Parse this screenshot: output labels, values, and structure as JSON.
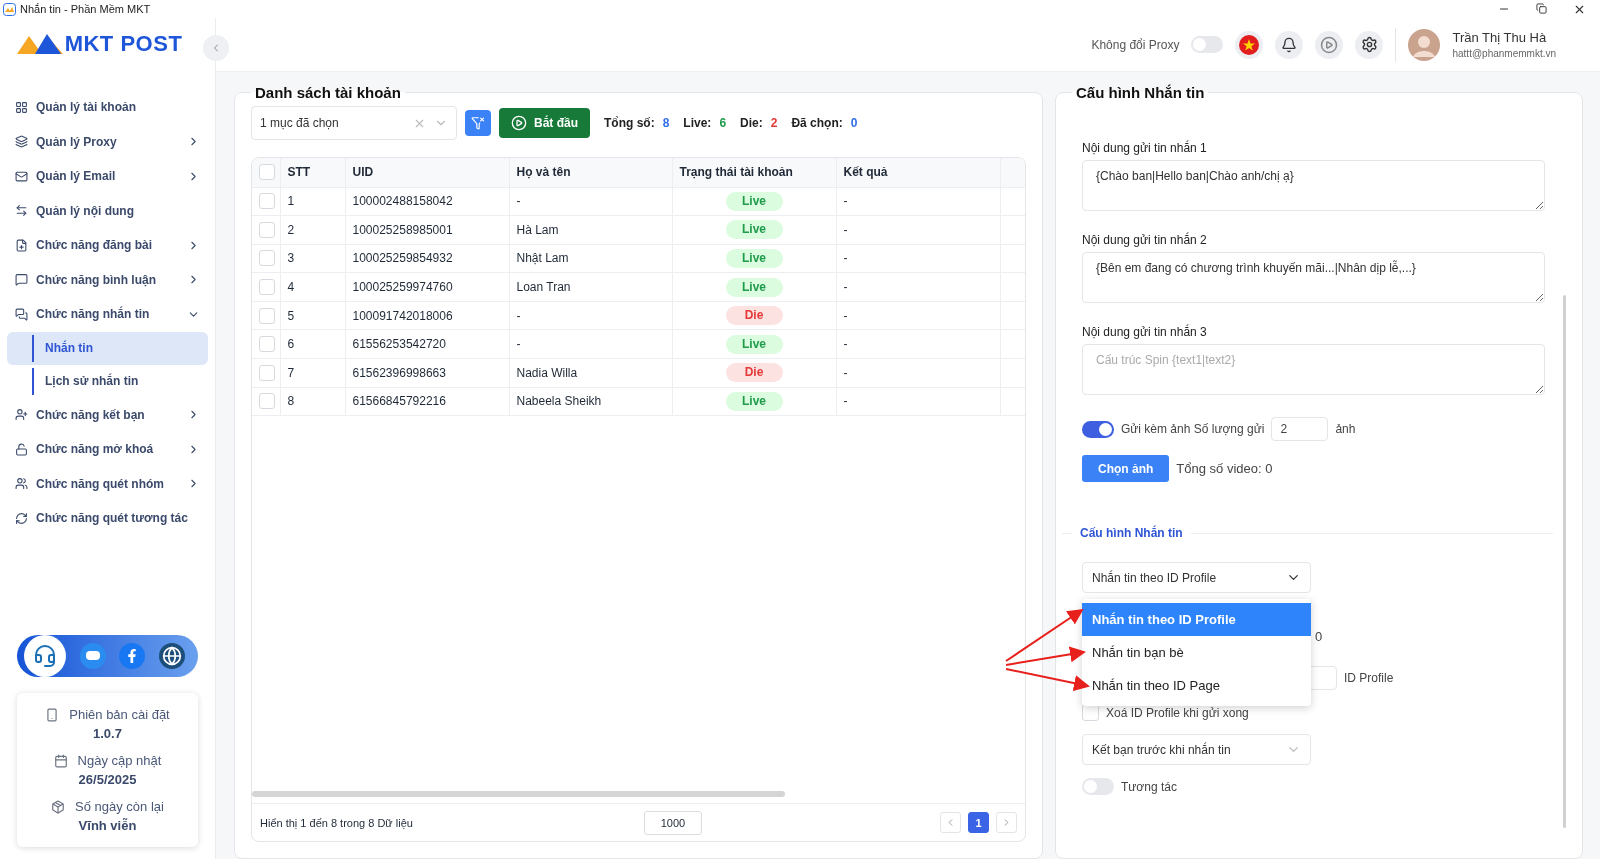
{
  "window": {
    "title": "Nhắn tin - Phần Mềm MKT"
  },
  "sidebar": {
    "logo": "MKT POST",
    "items": [
      {
        "label": "Quản lý tài khoản",
        "kind": "link",
        "selected": false
      },
      {
        "label": "Quản lý Proxy",
        "kind": "group",
        "selected": false,
        "expanded": false
      },
      {
        "label": "Quản lý Email",
        "kind": "group",
        "selected": false,
        "expanded": false
      },
      {
        "label": "Quản lý nội dung",
        "kind": "link",
        "selected": false
      },
      {
        "label": "Chức năng đăng bài",
        "kind": "group",
        "selected": false,
        "expanded": false
      },
      {
        "label": "Chức năng bình luận",
        "kind": "group",
        "selected": false,
        "expanded": false
      },
      {
        "label": "Chức năng nhắn tin",
        "kind": "group",
        "selected": false,
        "expanded": true,
        "children": [
          {
            "label": "Nhắn tin",
            "selected": true
          },
          {
            "label": "Lịch sử nhắn tin",
            "selected": false
          }
        ]
      },
      {
        "label": "Chức năng kết bạn",
        "kind": "group",
        "selected": false,
        "expanded": false
      },
      {
        "label": "Chức năng mở khoá",
        "kind": "group",
        "selected": false,
        "expanded": false
      },
      {
        "label": "Chức năng quét nhóm",
        "kind": "group",
        "selected": false,
        "expanded": false
      },
      {
        "label": "Chức năng quét tương tác",
        "kind": "link",
        "selected": false
      }
    ],
    "info": [
      {
        "label": "Phiên bản cài đặt",
        "value": "1.0.7"
      },
      {
        "label": "Ngày cập nhật",
        "value": "26/5/2025"
      },
      {
        "label": "Số ngày còn lại",
        "value": "Vĩnh viễn"
      }
    ]
  },
  "header": {
    "proxy": {
      "label": "Không đổi Proxy",
      "on": false
    },
    "user": {
      "name": "Trần Thị Thu Hà",
      "email": "hattt@phanmemmkt.vn"
    }
  },
  "accounts": {
    "title": "Danh sách tài khoản",
    "select": {
      "value": "1 mục đã chọn"
    },
    "start_button": "Bắt đầu",
    "stats": [
      {
        "label": "Tổng số:",
        "value": "8",
        "color": "#2f6fe8"
      },
      {
        "label": "Live:",
        "value": "6",
        "color": "#1e9b4b"
      },
      {
        "label": "Die:",
        "value": "2",
        "color": "#e53935"
      },
      {
        "label": "Đã chọn:",
        "value": "0",
        "color": "#2f6fe8"
      }
    ],
    "select_all": {
      "checked": false
    },
    "columns": [
      "STT",
      "UID",
      "Họ và tên",
      "Trạng thái tài khoản",
      "Kết quả"
    ],
    "rows": [
      {
        "stt": "1",
        "uid": "100002488158042",
        "name": "-",
        "status": "Live",
        "kind": "live",
        "result": "-",
        "checked": false
      },
      {
        "stt": "2",
        "uid": "100025258985001",
        "name": "Hà Lam",
        "status": "Live",
        "kind": "live",
        "result": "-",
        "checked": false
      },
      {
        "stt": "3",
        "uid": "100025259854932",
        "name": "Nhật Lam",
        "status": "Live",
        "kind": "live",
        "result": "-",
        "checked": false
      },
      {
        "stt": "4",
        "uid": "100025259974760",
        "name": "Loan Tran",
        "status": "Live",
        "kind": "live",
        "result": "-",
        "checked": false
      },
      {
        "stt": "5",
        "uid": "100091742018006",
        "name": "-",
        "status": "Die",
        "kind": "die",
        "result": "-",
        "checked": false
      },
      {
        "stt": "6",
        "uid": "61556253542720",
        "name": "-",
        "status": "Live",
        "kind": "live",
        "result": "-",
        "checked": false
      },
      {
        "stt": "7",
        "uid": "61562396998663",
        "name": "Nadia Willa",
        "status": "Die",
        "kind": "die",
        "result": "-",
        "checked": false
      },
      {
        "stt": "8",
        "uid": "61566845792216",
        "name": "Nabeela Sheikh",
        "status": "Live",
        "kind": "live",
        "result": "-",
        "checked": false
      }
    ],
    "footer": {
      "summary": "Hiển thị 1 đến 8 trong 8 Dữ liệu",
      "page_size": "1000",
      "pages": [
        {
          "label": "1",
          "selected": true
        }
      ]
    }
  },
  "config": {
    "title": "Cấu hình Nhắn tin",
    "messages": [
      {
        "label": "Nội dung gửi tin nhắn 1",
        "value": "{Chào ban|Hello ban|Chào anh/chị ạ}"
      },
      {
        "label": "Nội dung gửi tin nhắn 2",
        "value": "{Bên em đang có chương trình khuyến mãi...|Nhân dịp lễ,...}"
      },
      {
        "label": "Nội dung gửi tin nhắn 3",
        "placeholder": "Cấu trúc Spin {text1|text2}"
      }
    ],
    "attach": {
      "on": true,
      "label": "Gửi kèm ảnh Số lượng gửi",
      "count": "2",
      "unit": "ảnh"
    },
    "choose_button": "Chọn ảnh",
    "video_total": "Tổng số video: 0",
    "section_title": "Cấu hình Nhắn tin",
    "mode_select": {
      "value": "Nhắn tin theo ID Profile",
      "options": [
        {
          "label": "Nhắn tin theo ID Profile",
          "selected": true
        },
        {
          "label": "Nhắn tin bạn bè",
          "selected": false
        },
        {
          "label": "Nhắn tin theo ID Page",
          "selected": false
        }
      ]
    },
    "hidden_value": "0",
    "id_profile_label": "ID Profile",
    "delete_option": {
      "label": "Xoá ID Profile khi gửi xong",
      "checked": false
    },
    "friend_select": {
      "value": "Kết bạn trước khi nhắn tin"
    },
    "interaction": {
      "label": "Tương tác",
      "on": false
    }
  }
}
